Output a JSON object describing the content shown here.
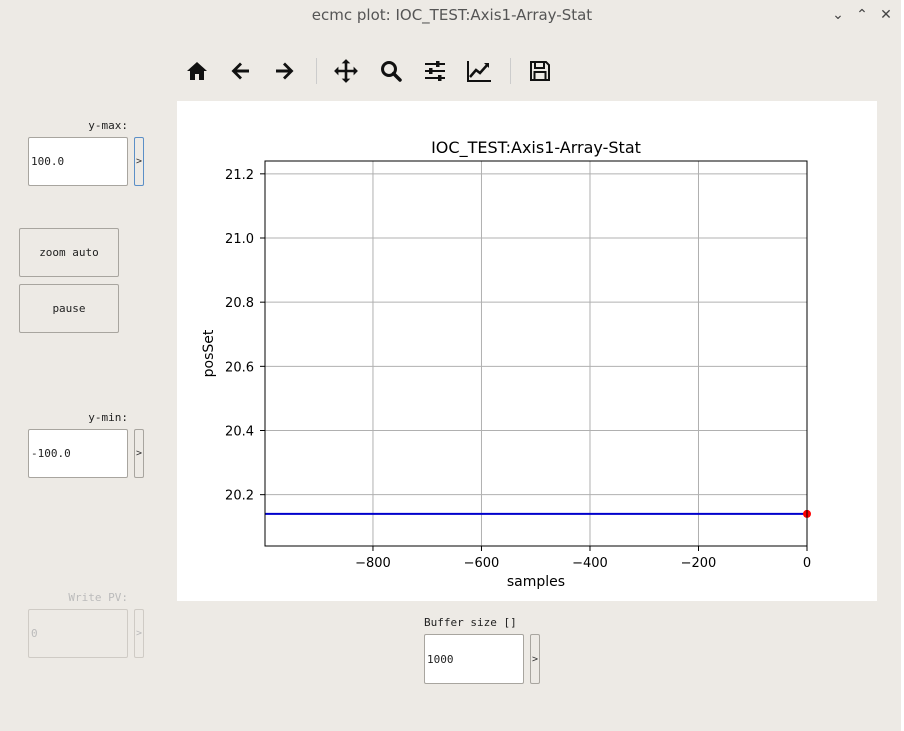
{
  "window": {
    "title": "ecmc plot: IOC_TEST:Axis1-Array-Stat",
    "minimize_glyph": "⌄",
    "maximize_glyph": "⌃",
    "close_glyph": "✕"
  },
  "toolbar": {
    "buttons": [
      {
        "icon": "home-icon"
      },
      {
        "icon": "back-arrow-icon"
      },
      {
        "icon": "forward-arrow-icon"
      },
      {
        "icon": "pan-move-icon"
      },
      {
        "icon": "zoom-magnifier-icon"
      },
      {
        "icon": "configure-subplots-icon"
      },
      {
        "icon": "edit-axis-curve-icon"
      },
      {
        "icon": "save-floppy-icon"
      }
    ]
  },
  "controls": {
    "ymax_label": "y-max:",
    "ymax_value": "100.0",
    "ymin_label": "y-min:",
    "ymin_value": "-100.0",
    "zoom_auto_label": "zoom auto",
    "pause_label": "pause",
    "write_pv_label": "Write PV:",
    "write_pv_value": "0",
    "buffer_label": "Buffer size []",
    "buffer_value": "1000",
    "arrow_glyph": ">"
  },
  "colors": {
    "line": "#0000cc",
    "marker": "#ff0000",
    "grid": "#b0b0b0"
  },
  "chart_data": {
    "type": "line",
    "title": "IOC_TEST:Axis1-Array-Stat",
    "xlabel": "samples",
    "ylabel": "posSet",
    "xlim": [
      -999,
      0
    ],
    "ylim": [
      20.04,
      21.24
    ],
    "xticks": [
      -800,
      -600,
      -400,
      -200,
      0
    ],
    "xtick_labels": [
      "−800",
      "−600",
      "−400",
      "−200",
      "0"
    ],
    "yticks": [
      20.2,
      20.4,
      20.6,
      20.8,
      21.0,
      21.2
    ],
    "ytick_labels": [
      "20.2",
      "20.4",
      "20.6",
      "20.8",
      "21.0",
      "21.2"
    ],
    "grid": true,
    "series": [
      {
        "x": [
          -999,
          0
        ],
        "y": [
          20.14,
          20.14
        ]
      }
    ],
    "marker_point": {
      "x": 0,
      "y": 20.14
    }
  }
}
